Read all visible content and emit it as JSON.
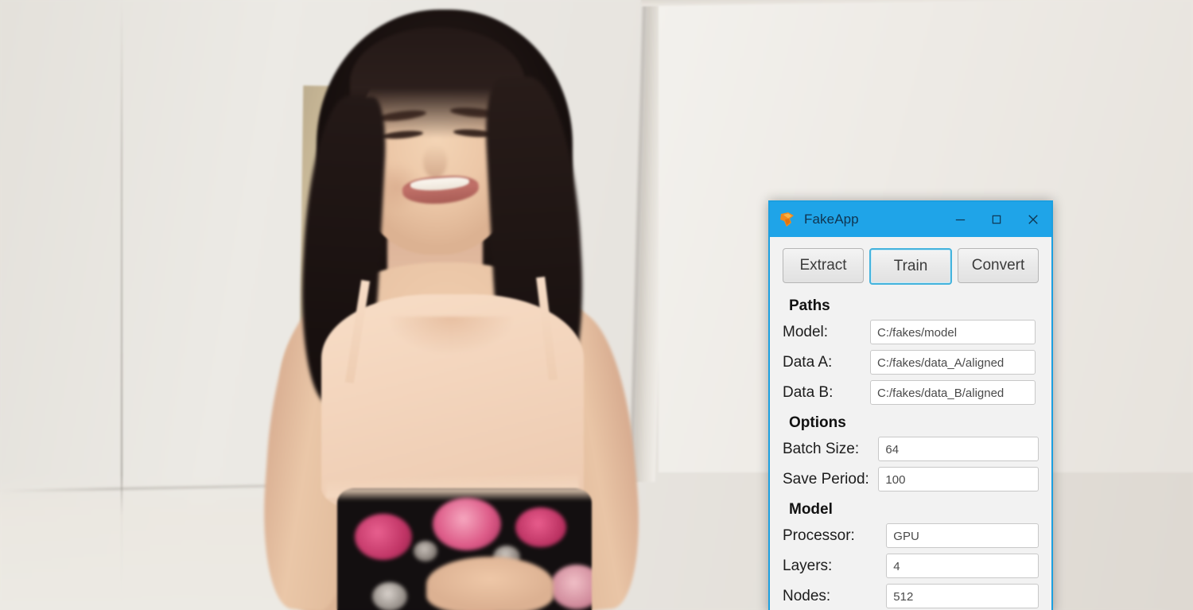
{
  "background": {
    "description": "blurred video still of a smiling dark-haired woman in a peach camisole and black floral skirt standing in front of a light wall with a white door",
    "wall_color": "#e8e5e0",
    "door_color": "#f1eee9",
    "board_color": "#bda98a",
    "hair_color": "#1d1412",
    "skin_color": "#ecc7a7",
    "top_color": "#f3d5bd",
    "skirt_color": "#130f10",
    "skirt_flower_color": "#c13566"
  },
  "window": {
    "title": "FakeApp",
    "icon": "fakeapp-logo-icon",
    "accent_color": "#1fa4e8",
    "controls": {
      "minimize": "minimize-icon",
      "maximize": "maximize-icon",
      "close": "close-icon"
    },
    "tabs": [
      {
        "label": "Extract",
        "active": false
      },
      {
        "label": "Train",
        "active": true
      },
      {
        "label": "Convert",
        "active": false
      }
    ],
    "sections": [
      {
        "title": "Paths",
        "fields": [
          {
            "label": "Model:",
            "value": "C:/fakes/model"
          },
          {
            "label": "Data A:",
            "value": "C:/fakes/data_A/aligned"
          },
          {
            "label": "Data B:",
            "value": "C:/fakes/data_B/aligned"
          }
        ]
      },
      {
        "title": "Options",
        "fields": [
          {
            "label": "Batch Size:",
            "value": "64"
          },
          {
            "label": "Save Period:",
            "value": "100"
          }
        ]
      },
      {
        "title": "Model",
        "fields": [
          {
            "label": "Processor:",
            "value": "GPU"
          },
          {
            "label": "Layers:",
            "value": "4"
          },
          {
            "label": "Nodes:",
            "value": "512"
          }
        ]
      }
    ]
  }
}
